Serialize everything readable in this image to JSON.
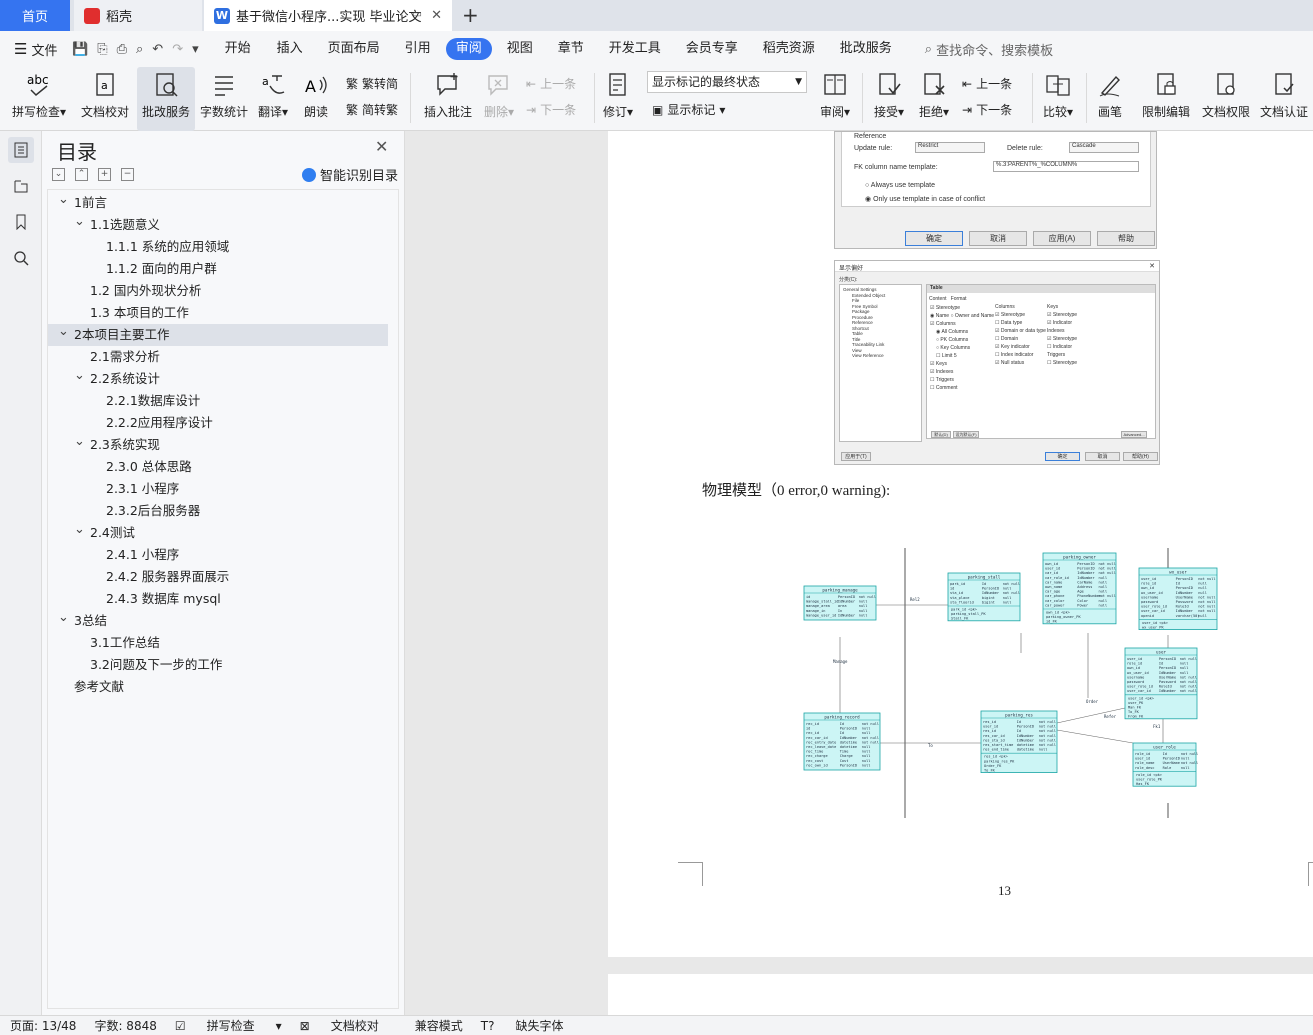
{
  "tabs": {
    "home": "首页",
    "daoke": "稻壳",
    "document": "基于微信小程序...实现 毕业论文"
  },
  "menu": {
    "file": "文件",
    "items": [
      "开始",
      "插入",
      "页面布局",
      "引用",
      "审阅",
      "视图",
      "章节",
      "开发工具",
      "会员专享",
      "稻壳资源",
      "批改服务"
    ],
    "active": "审阅",
    "search": "查找命令、搜索模板"
  },
  "ribbon": {
    "spell": "拼写检查",
    "proof": "文档校对",
    "review_service": "批改服务",
    "word_count": "字数统计",
    "translate": "翻译",
    "read": "朗读",
    "to_trad": "繁转简",
    "to_simp": "简转繁",
    "insert_comment": "插入批注",
    "delete": "删除",
    "prev": "上一条",
    "next": "下一条",
    "track": "修订",
    "markup_state": "显示标记的最终状态",
    "show_markup": "显示标记",
    "review": "审阅",
    "accept": "接受",
    "reject": "拒绝",
    "prev2": "上一条",
    "next2": "下一条",
    "compare": "比较",
    "pen": "画笔",
    "restrict": "限制编辑",
    "doc_rights": "文档权限",
    "doc_cert": "文档认证"
  },
  "toc": {
    "title": "目录",
    "ai": "智能识别目录",
    "items": [
      {
        "text": "1前言",
        "level": 0,
        "caret": "v"
      },
      {
        "text": "1.1选题意义",
        "level": 1,
        "caret": "v"
      },
      {
        "text": "1.1.1  系统的应用领域",
        "level": 2,
        "caret": ""
      },
      {
        "text": "1.1.2  面向的用户群",
        "level": 2,
        "caret": ""
      },
      {
        "text": "1.2  国内外现状分析",
        "level": 1,
        "caret": ""
      },
      {
        "text": "1.3  本项目的工作",
        "level": 1,
        "caret": ""
      },
      {
        "text": "2本项目主要工作",
        "level": 0,
        "caret": "v",
        "highlight": true
      },
      {
        "text": "2.1需求分析",
        "level": 1,
        "caret": ""
      },
      {
        "text": "2.2系统设计",
        "level": 1,
        "caret": "v"
      },
      {
        "text": "2.2.1数据库设计",
        "level": 2,
        "caret": ""
      },
      {
        "text": "2.2.2应用程序设计",
        "level": 2,
        "caret": ""
      },
      {
        "text": "2.3系统实现",
        "level": 1,
        "caret": "v"
      },
      {
        "text": "2.3.0  总体思路",
        "level": 2,
        "caret": ""
      },
      {
        "text": "2.3.1  小程序",
        "level": 2,
        "caret": ""
      },
      {
        "text": "2.3.2后台服务器",
        "level": 2,
        "caret": ""
      },
      {
        "text": "2.4测试",
        "level": 1,
        "caret": "v"
      },
      {
        "text": "2.4.1  小程序",
        "level": 2,
        "caret": ""
      },
      {
        "text": "2.4.2  服务器界面展示",
        "level": 2,
        "caret": ""
      },
      {
        "text": "2.4.3  数据库 mysql",
        "level": 2,
        "caret": ""
      },
      {
        "text": "3总结",
        "level": 0,
        "caret": "v"
      },
      {
        "text": "3.1工作总结",
        "level": 1,
        "caret": ""
      },
      {
        "text": "3.2问题及下一步的工作",
        "level": 1,
        "caret": ""
      },
      {
        "text": "参考文献",
        "level": 0,
        "caret": ""
      }
    ]
  },
  "doc": {
    "dlg1": {
      "reference": "Reference",
      "update_rule": "Update rule:",
      "update_val": "Restrict",
      "delete_rule": "Delete rule:",
      "delete_val": "Cascade",
      "fk_template": "FK column name template:",
      "fk_val": "%.3:PARENT%_%COLUMN%",
      "always": "Always use template",
      "only": "Only use template in case of conflict",
      "ok": "确定",
      "cancel": "取消",
      "apply": "应用(A)",
      "help": "帮助"
    },
    "dlg2": {
      "title": "显示偏好",
      "category": "分类(C):",
      "tree": [
        "General Settings",
        "Extended Object",
        "File",
        "Free Symbol",
        "Package",
        "Procedure",
        "Reference",
        "Shortcut",
        "Table",
        "Title",
        "Traceability Link",
        "View",
        "View Reference"
      ],
      "panel": "Table",
      "content": "Content",
      "format": "Format",
      "stereotype": "Stereotype",
      "name": "Name",
      "owner_name": "Owner and Name",
      "columns": "Columns",
      "all_columns": "All Columns",
      "pk_columns": "PK Columns",
      "key_columns": "Key Columns",
      "limit": "Limit",
      "limit_val": "5",
      "keys": "Keys",
      "indexes": "Indexes",
      "triggers": "Triggers",
      "comment": "Comment",
      "col_head": "Columns",
      "col_items": [
        "Stereotype",
        "Data type",
        "Domain or data type",
        "Domain",
        "Key indicator",
        "Index indicator",
        "Null status"
      ],
      "keys_head": "Keys",
      "keys_items": [
        "Stereotype",
        "Indicator"
      ],
      "idx_head": "Indexes",
      "idx_items": [
        "Stereotype",
        "Indicator"
      ],
      "trg_head": "Triggers",
      "trg_items": [
        "Stereotype"
      ],
      "set_default": "默认(D)",
      "as_default": "设为默认(F)",
      "advanced": "Advanced...",
      "apply_to": "应用于(T)",
      "ok": "确定",
      "cancel": "取消",
      "help": "帮助(H)"
    },
    "caption": "物理模型（0 error,0 warning):",
    "page_number": "13"
  },
  "erd": {
    "line_color": "#1ba5a5",
    "fill_color": "#ccf5f5",
    "tables": [
      {
        "title": "parking_manage",
        "rows": [
          [
            "id",
            "PersonID",
            "not null"
          ],
          [
            "manage_stall_id",
            "IdNumber",
            "null"
          ],
          [
            "manage_area",
            "area",
            "null"
          ],
          [
            "manage_in",
            "In",
            "null"
          ],
          [
            "manage_user_id",
            "IdNumber",
            "null"
          ]
        ],
        "foot": []
      },
      {
        "title": "parking_stall",
        "rows": [
          [
            "park_id",
            "Id",
            "not null"
          ],
          [
            "id",
            "PersonID",
            "null"
          ],
          [
            "sta_id",
            "IdNumber",
            "not null"
          ],
          [
            "sta_place",
            "bigint",
            "null"
          ],
          [
            "sta_floorid",
            "bigint",
            "null"
          ]
        ],
        "foot": [
          "park_id <pk>",
          "parking_stall_PK",
          "Stall_FK"
        ]
      },
      {
        "title": "parking_owner",
        "rows": [
          [
            "own_id",
            "PersonID",
            "not null"
          ],
          [
            "user_id",
            "PersonID",
            "not null"
          ],
          [
            "car_id",
            "IdNumber",
            "not null"
          ],
          [
            "car_role_id",
            "IdNumber",
            "null"
          ],
          [
            "car_name",
            "CarName",
            "null"
          ],
          [
            "own_name",
            "Address",
            "null"
          ],
          [
            "car_age",
            "Age",
            "null"
          ],
          [
            "car_phone",
            "PhoneNumber",
            "not null"
          ],
          [
            "car_color",
            "Color",
            "null"
          ],
          [
            "car_power",
            "Power",
            "null"
          ]
        ],
        "foot": [
          "own_id <pk>",
          "parking_owner_PK",
          "id_FK"
        ]
      },
      {
        "title": "wx_user",
        "rows": [
          [
            "user_id",
            "PersonID",
            "not null"
          ],
          [
            "role_id",
            "Id",
            "null"
          ],
          [
            "own_id",
            "PersonID",
            "null"
          ],
          [
            "wx_user_id",
            "IdNumber",
            "null"
          ],
          [
            "username",
            "UserName",
            "not null"
          ],
          [
            "password",
            "Password",
            "not null"
          ],
          [
            "user_role_id",
            "RoleId",
            "not null"
          ],
          [
            "user_car_id",
            "IdNumber",
            "not null"
          ],
          [
            "openid",
            "varchar(50)",
            "null"
          ]
        ],
        "foot": [
          "user_id <pk>",
          "wx_user_PK"
        ]
      },
      {
        "title": "user",
        "rows": [
          [
            "user_id",
            "PersonID",
            "not null"
          ],
          [
            "role_id",
            "Id",
            "null"
          ],
          [
            "own_id",
            "PersonID",
            "null"
          ],
          [
            "wx_user_id",
            "IdNumber",
            "null"
          ],
          [
            "username",
            "UserName",
            "not null"
          ],
          [
            "password",
            "Password",
            "not null"
          ],
          [
            "user_role_id",
            "RoleId",
            "not null"
          ],
          [
            "user_car_id",
            "IdNumber",
            "not null"
          ]
        ],
        "foot": [
          "user_id <pk>",
          "user_PK",
          "Man_FK",
          "To_FK",
          "From_FK"
        ]
      },
      {
        "title": "parking_record",
        "rows": [
          [
            "rec_id",
            "Id",
            "not null"
          ],
          [
            "id",
            "PersonID",
            "null"
          ],
          [
            "rec_id",
            "Id",
            "null"
          ],
          [
            "rec_car_id",
            "IdNumber",
            "not null"
          ],
          [
            "rec_entry_date",
            "datetime",
            "not null"
          ],
          [
            "rec_leave_date",
            "datetime",
            "null"
          ],
          [
            "rec_time",
            "Time",
            "null"
          ],
          [
            "rec_charge",
            "Charge",
            "null"
          ],
          [
            "rec_cost",
            "Cost",
            "null"
          ],
          [
            "rec_own_id",
            "PersonID",
            "null"
          ]
        ],
        "foot": []
      },
      {
        "title": "parking_res",
        "rows": [
          [
            "res_id",
            "Id",
            "not null"
          ],
          [
            "user_id",
            "PersonID",
            "not null"
          ],
          [
            "res_id",
            "Id",
            "not null"
          ],
          [
            "res_car_id",
            "IdNumber",
            "not null"
          ],
          [
            "res_sta_id",
            "IdNumber",
            "not null"
          ],
          [
            "res_start_time",
            "datetime",
            "not null"
          ],
          [
            "res_end_time",
            "datetime",
            "null"
          ]
        ],
        "foot": [
          "res_id <pk>",
          "parking_res_PK",
          "Order_FK",
          "To_FK"
        ]
      },
      {
        "title": "user_role",
        "rows": [
          [
            "role_id",
            "Id",
            "not null"
          ],
          [
            "user_id",
            "PersonID",
            "null"
          ],
          [
            "role_name",
            "UserName",
            "not null"
          ],
          [
            "role_desc",
            "Role",
            "null"
          ]
        ],
        "foot": [
          "role_id <pk>",
          "user_role_PK",
          "Has_FK"
        ]
      }
    ],
    "labels": [
      "Rel2",
      "Manage",
      "To",
      "Order",
      "Refer",
      "Fk1"
    ]
  },
  "status": {
    "page": "页面: 13/48",
    "words": "字数: 8848",
    "spell": "拼写检查",
    "proof": "文档校对",
    "compat": "兼容模式",
    "missing_font": "缺失字体"
  }
}
